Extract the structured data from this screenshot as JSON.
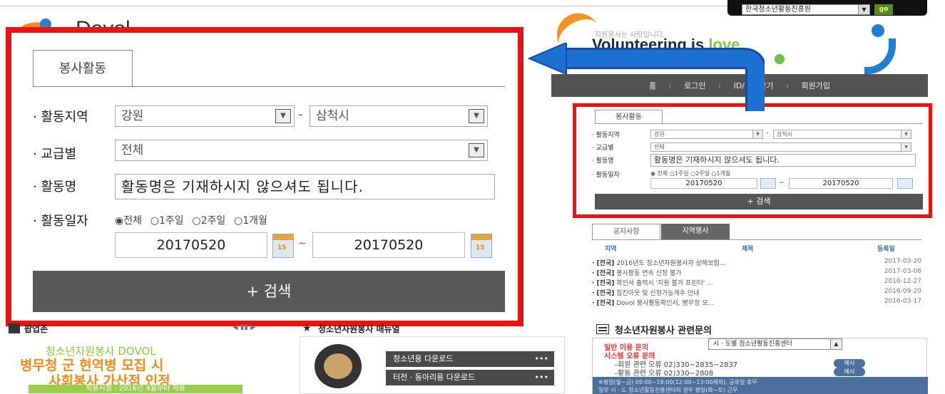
{
  "topbar": {
    "org_select": "한국청소년활동진흥원",
    "go": "go"
  },
  "logo": {
    "text": "Dovol"
  },
  "brand": {
    "tagline": "자원봉사는 사랑입니다.",
    "slogan_main": "Volunteering is ",
    "slogan_love": "love"
  },
  "nav": {
    "items": [
      "홈",
      "로그인",
      "ID/비번찾기",
      "회원가입"
    ]
  },
  "form": {
    "tab": "봉사활동",
    "region_label": "· 활동지역",
    "region_province": "강원",
    "region_sep": "-",
    "region_city": "삼척시",
    "grade_label": "· 교급별",
    "grade_value": "전체",
    "activity_label": "· 활동명",
    "activity_value": "활동명은 기재하시지 않으셔도 됩니다.",
    "date_label": "· 활동일자",
    "period_options": [
      "전체",
      "1주일",
      "2주일",
      "1개월"
    ],
    "period_selected": "전체",
    "date_from": "20170520",
    "date_sep": "~",
    "date_to": "20170520",
    "search_label": "+ 검색"
  },
  "notice": {
    "tabs": [
      "공지사항",
      "지역행사"
    ],
    "columns": [
      "지역",
      "제목",
      "등록일"
    ],
    "rows": [
      {
        "region": "· [전국]",
        "title": "2016년도 청소년자원봉사자 상해보험...",
        "date": "2017-03-20"
      },
      {
        "region": "· [전국]",
        "title": "봉사활동 연속 신청 불가",
        "date": "2017-03-08"
      },
      {
        "region": "· [전국]",
        "title": "확인서 출력시 '지원 불가 프린터' ...",
        "date": "2016-12-27"
      },
      {
        "region": "· [전국]",
        "title": "참진아웃 및 신청가능개수 안내",
        "date": "2016-09-20"
      },
      {
        "region": "· [전국]",
        "title": "Dovol 봉사활동확인서, 병무청 모...",
        "date": "2016-03-17"
      }
    ]
  },
  "bottom_left": {
    "heading": "팝업존",
    "promo_l1": "청소년자원봉사 DOVOL",
    "promo_l2": "병무청 군 현역병 모집 시",
    "promo_l3": "사회봉사 가산점 인정",
    "promo_l4": "적용시점 : 2016년 4월부터 적용"
  },
  "bottom_middle": {
    "heading": "청소년자원봉사 매뉴얼",
    "btn1": "청소년용 다운로드",
    "btn2": "터전 · 동아리용 다운로드",
    "dots": "•••"
  },
  "bottom_right": {
    "heading": "청소년자원봉사 관련문의",
    "general": "일반 이용 문의",
    "center_select": "시 · 도별 청소년활동진흥센터",
    "system": "시스템 오류 문의",
    "member": "–회원 관련 오류  02)330−2835~2837",
    "hours": "–활동 관련 오류  02)330−2808",
    "example": "예시",
    "footer1": "※평일(월~금) 09:00~18:00(12:00~13:00제외), 공휴일 휴무",
    "footer2": "일부 시 · 도 청소년활동진흥센터의 경우 평일(화~토) 근무"
  },
  "colors": {
    "highlight": "#ee1111",
    "nav_bg": "#525252",
    "accent_green": "#8cc63f",
    "accent_orange": "#f28a1e",
    "arrow_blue": "#1e6fd2"
  }
}
